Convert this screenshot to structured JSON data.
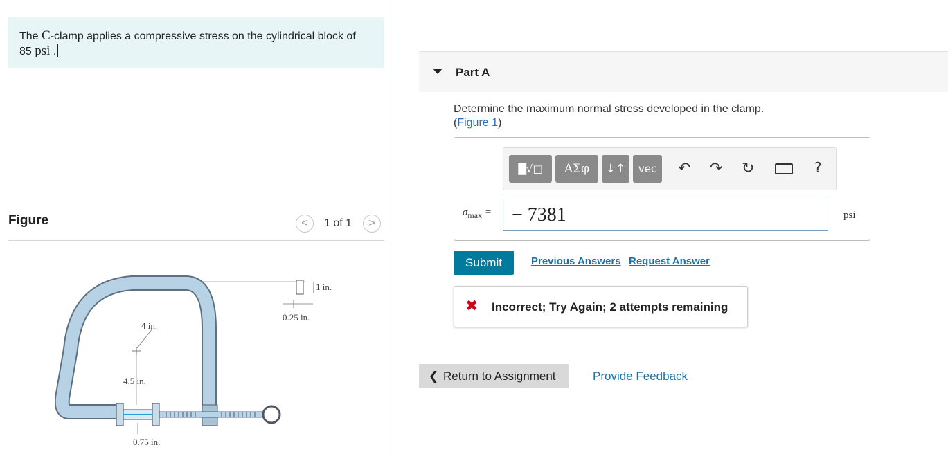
{
  "problem": {
    "text_pre": "The ",
    "text_c": "C",
    "text_post": "-clamp applies a compressive stress on the cylindrical block of",
    "value": "85",
    "unit": "psi",
    "period": "."
  },
  "figure_panel": {
    "title": "Figure",
    "counter": "1 of 1",
    "prev_glyph": "<",
    "next_glyph": ">",
    "labels": {
      "top": "1 in.",
      "gap": "0.25 in.",
      "radius": "4 in.",
      "height": "4.5 in.",
      "diameter": "0.75 in."
    }
  },
  "part": {
    "title": "Part A",
    "question": "Determine the maximum normal stress developed in the clamp.",
    "figure_link_open": "(",
    "figure_link": "Figure 1",
    "figure_link_close": ")"
  },
  "toolbar": {
    "b1": "█√□",
    "b2": "ΑΣφ",
    "b3": "↓↑",
    "b4": "vec",
    "undo": "↶",
    "redo": "↷",
    "reset": "↻",
    "help": "?"
  },
  "answer": {
    "symbol": "σ",
    "subscript": "max",
    "equals": " =",
    "value": "− 7381",
    "unit": "psi"
  },
  "actions": {
    "submit": "Submit",
    "previous": "Previous Answers",
    "request": "Request Answer"
  },
  "feedback": {
    "icon": "✖",
    "text": "Incorrect; Try Again; 2 attempts remaining"
  },
  "footer": {
    "return_chevron": "❮",
    "return_label": "Return to Assignment",
    "provide_feedback": "Provide Feedback"
  },
  "colors": {
    "accent": "#007b9e",
    "link": "#1a73a8",
    "error": "#d0021b",
    "problem_bg": "#e8f5f7"
  }
}
